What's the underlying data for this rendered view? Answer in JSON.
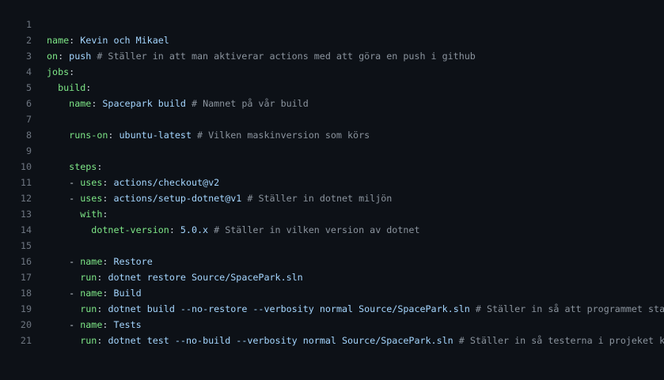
{
  "editor": {
    "lines": [
      {
        "num": "1",
        "indent": "",
        "key": "name",
        "colon": ":",
        "value": " Kevin och Mikael",
        "comment": ""
      },
      {
        "num": "2",
        "indent": "",
        "key": "on",
        "colon": ":",
        "value": " push",
        "comment": " # Ställer in att man aktiverar actions med att göra en push i github"
      },
      {
        "num": "3",
        "indent": "",
        "key": "jobs",
        "colon": ":",
        "value": "",
        "comment": ""
      },
      {
        "num": "4",
        "indent": "  ",
        "key": "build",
        "colon": ":",
        "value": "",
        "comment": ""
      },
      {
        "num": "5",
        "indent": "    ",
        "key": "name",
        "colon": ":",
        "value": " Spacepark build",
        "comment": " # Namnet på vår build"
      },
      {
        "num": "6",
        "indent": "",
        "key": "",
        "colon": "",
        "value": "",
        "comment": ""
      },
      {
        "num": "7",
        "indent": "    ",
        "key": "runs-on",
        "colon": ":",
        "value": " ubuntu-latest",
        "comment": " # Vilken maskinversion som körs"
      },
      {
        "num": "8",
        "indent": "",
        "key": "",
        "colon": "",
        "value": "",
        "comment": ""
      },
      {
        "num": "9",
        "indent": "    ",
        "key": "steps",
        "colon": ":",
        "value": "",
        "comment": ""
      },
      {
        "num": "10",
        "indent": "    - ",
        "key": "uses",
        "colon": ":",
        "value": " actions/checkout@v2",
        "comment": ""
      },
      {
        "num": "11",
        "indent": "    - ",
        "key": "uses",
        "colon": ":",
        "value": " actions/setup-dotnet@v1",
        "comment": " # Ställer in dotnet miljön"
      },
      {
        "num": "12",
        "indent": "      ",
        "key": "with",
        "colon": ":",
        "value": "",
        "comment": ""
      },
      {
        "num": "13",
        "indent": "        ",
        "key": "dotnet-version",
        "colon": ":",
        "value": " 5.0.x",
        "comment": " # Ställer in vilken version av dotnet"
      },
      {
        "num": "14",
        "indent": "",
        "key": "",
        "colon": "",
        "value": "",
        "comment": ""
      },
      {
        "num": "15",
        "indent": "    - ",
        "key": "name",
        "colon": ":",
        "value": " Restore",
        "comment": ""
      },
      {
        "num": "16",
        "indent": "      ",
        "key": "run",
        "colon": ":",
        "value": " dotnet restore Source/SpacePark.sln",
        "comment": ""
      },
      {
        "num": "17",
        "indent": "    - ",
        "key": "name",
        "colon": ":",
        "value": " Build",
        "comment": ""
      },
      {
        "num": "18",
        "indent": "      ",
        "key": "run",
        "colon": ":",
        "value": " dotnet build --no-restore --verbosity normal Source/SpacePark.sln",
        "comment": " # Ställer in så att programmet startar"
      },
      {
        "num": "19",
        "indent": "    - ",
        "key": "name",
        "colon": ":",
        "value": " Tests",
        "comment": ""
      },
      {
        "num": "20",
        "indent": "      ",
        "key": "run",
        "colon": ":",
        "value": " dotnet test --no-build --verbosity normal Source/SpacePark.sln",
        "comment": " # Ställer in så testerna i projeket körs"
      },
      {
        "num": "21",
        "indent": "",
        "key": "",
        "colon": "",
        "value": "",
        "comment": ""
      }
    ]
  }
}
